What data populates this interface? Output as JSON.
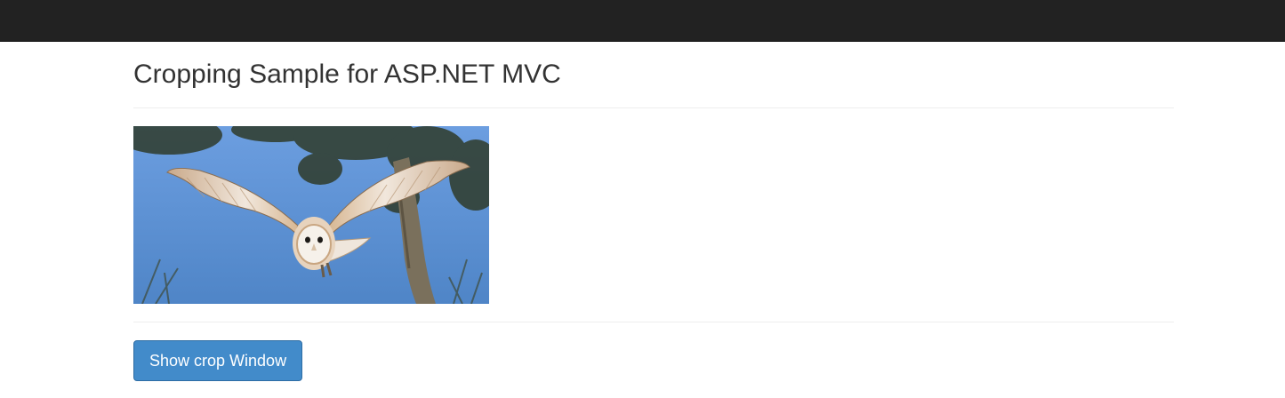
{
  "header": {
    "title": "Cropping Sample for ASP.NET MVC"
  },
  "image": {
    "description_icon": "barn-owl-photo"
  },
  "actions": {
    "show_crop_label": "Show crop Window"
  },
  "colors": {
    "navbar": "#222222",
    "button": "#428bca",
    "button_border": "#2e6da4",
    "sky": "#5b8fd0"
  }
}
